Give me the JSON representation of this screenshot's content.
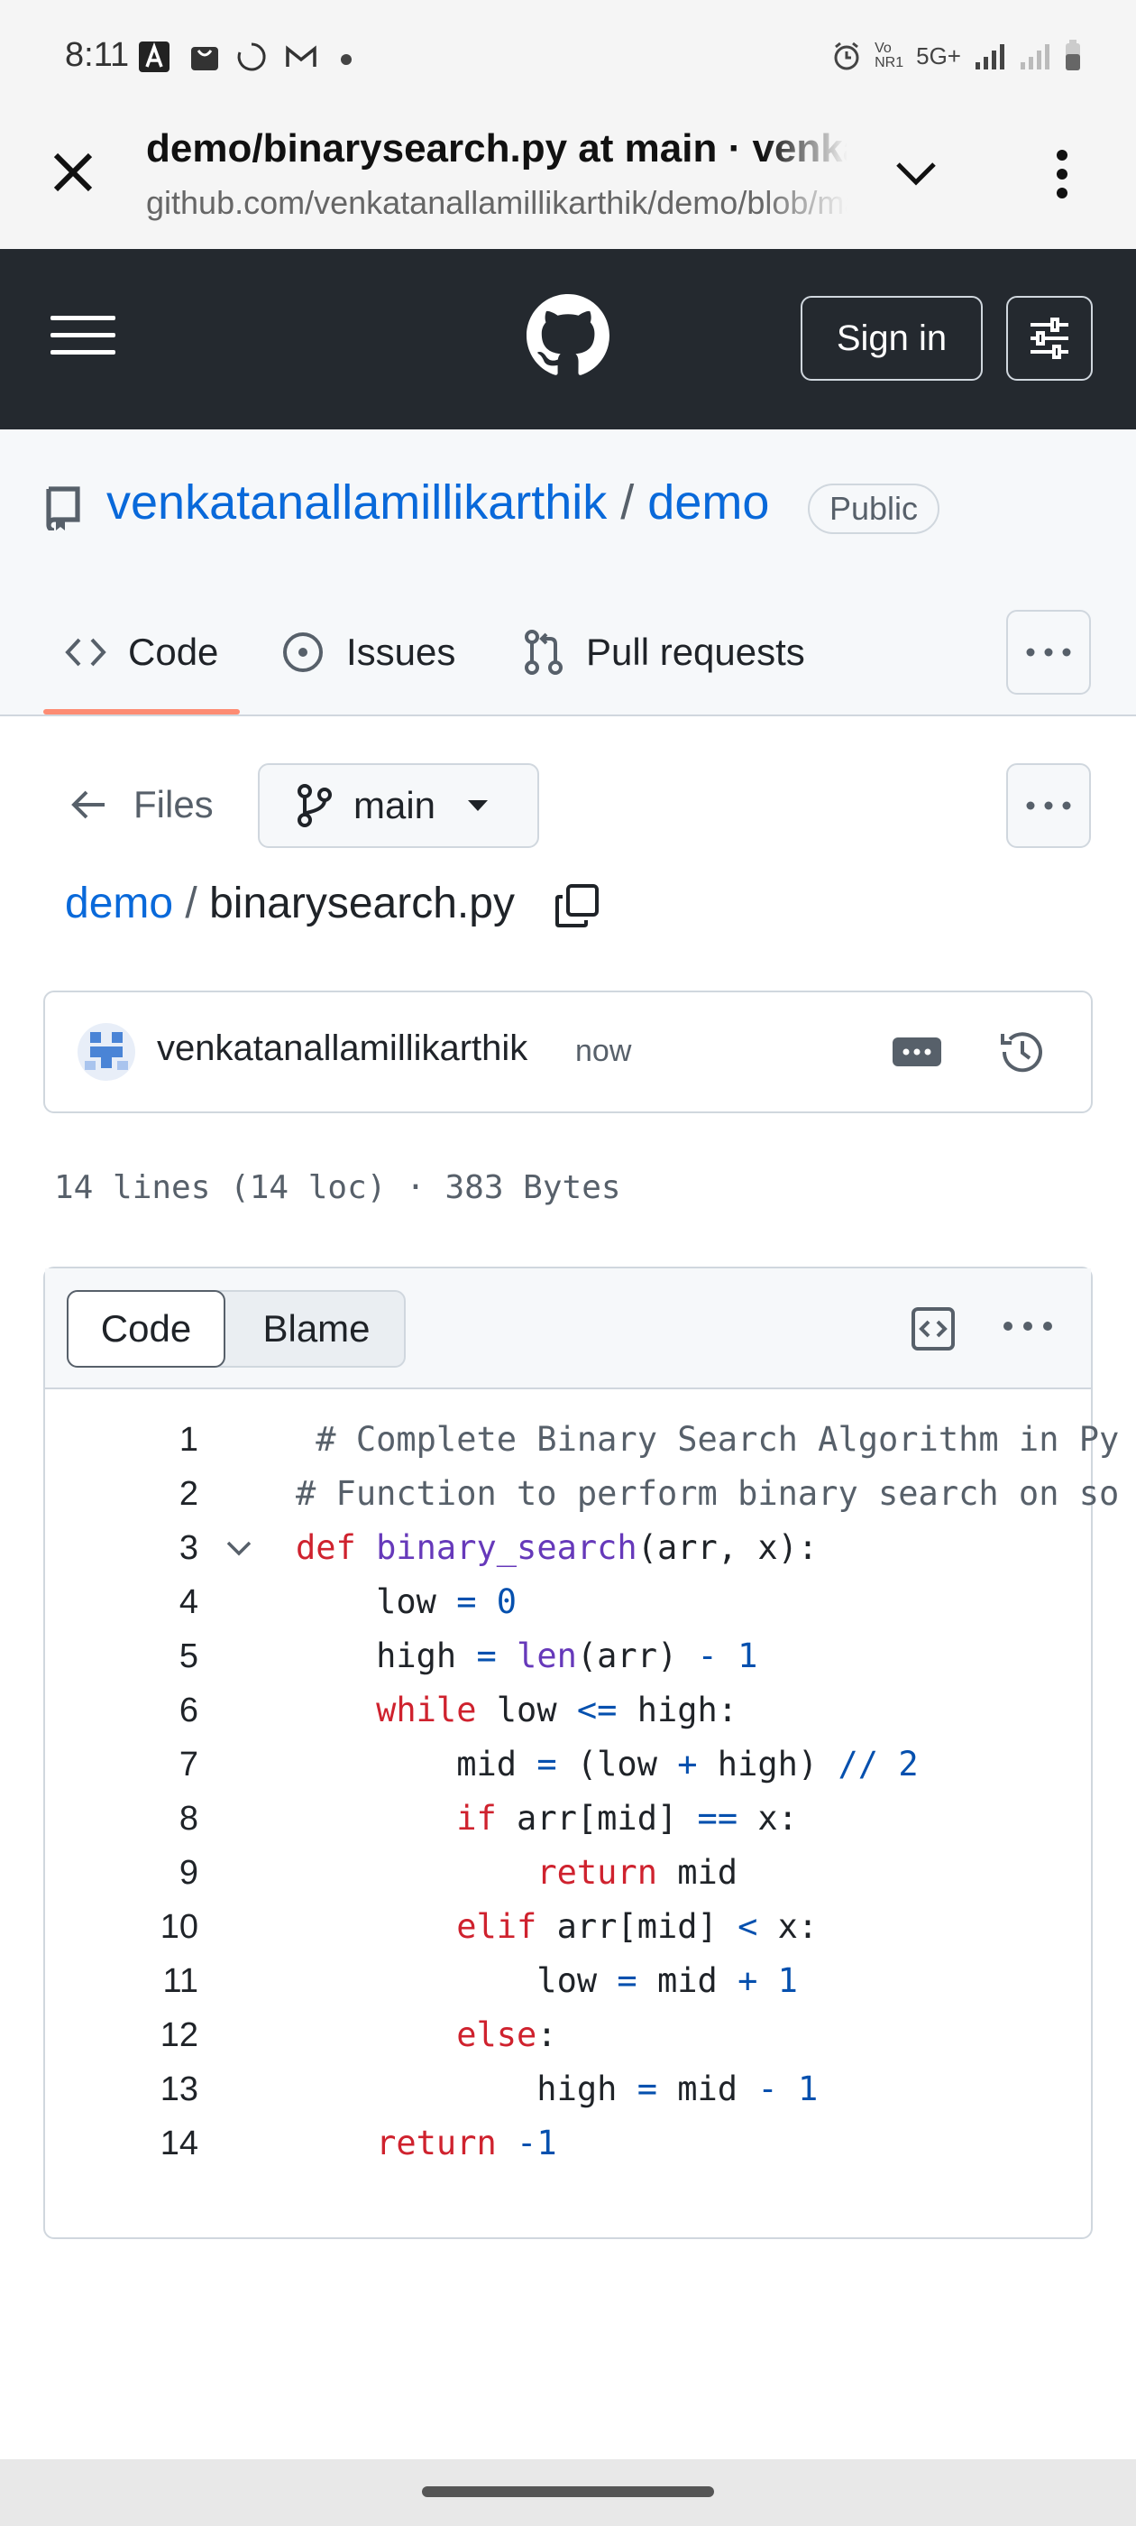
{
  "status_bar": {
    "time": "8:11",
    "network": "5G+"
  },
  "browser": {
    "page_title": "demo/binarysearch.py at main · venkatanallamillikarthik/demo",
    "url": "github.com/venkatanallamillikarthik/demo/blob/main/binarysearch.py"
  },
  "header": {
    "signin_label": "Sign in"
  },
  "repo": {
    "owner": "venkatanallamillikarthik",
    "separator": "/",
    "name": "demo",
    "visibility": "Public"
  },
  "tabs": [
    {
      "label": "Code"
    },
    {
      "label": "Issues"
    },
    {
      "label": "Pull requests"
    }
  ],
  "file_nav": {
    "files_label": "Files",
    "branch": "main"
  },
  "breadcrumb": {
    "repo": "demo",
    "separator": "/",
    "file": "binarysearch.py"
  },
  "commit": {
    "author": "venkatanallamillikarthik",
    "time": "now"
  },
  "file_meta": "14 lines (14 loc) · 383 Bytes",
  "view_toggle": {
    "code_label": "Code",
    "blame_label": "Blame"
  },
  "code": {
    "line_numbers": [
      "1",
      "2",
      "3",
      "4",
      "5",
      "6",
      "7",
      "8",
      "9",
      "10",
      "11",
      "12",
      "13",
      "14"
    ],
    "lines": [
      " # Complete Binary Search Algorithm in Py",
      "# Function to perform binary search on so",
      "def binary_search(arr, x):",
      "    low = 0",
      "    high = len(arr) - 1",
      "    while low <= high:",
      "        mid = (low + high) // 2",
      "        if arr[mid] == x:",
      "            return mid",
      "        elif arr[mid] < x:",
      "            low = mid + 1",
      "        else:",
      "            high = mid - 1",
      "    return -1"
    ]
  },
  "colors": {
    "header_bg": "#24292f",
    "link": "#0969da",
    "tab_underline": "#fd8c73",
    "keyword": "#cf222e",
    "function": "#6639ba",
    "number": "#0550ae"
  }
}
